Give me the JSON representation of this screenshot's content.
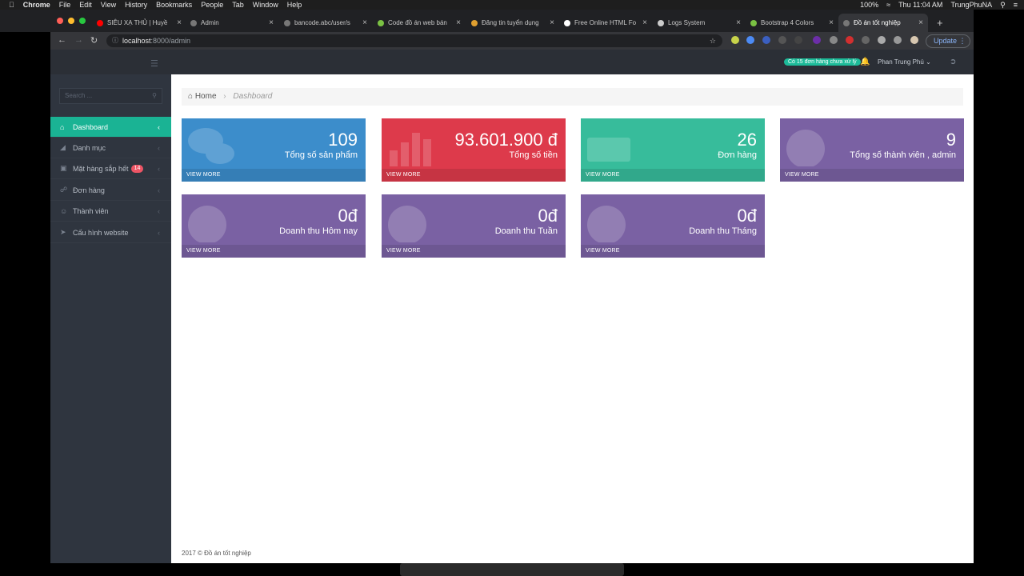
{
  "macmenu": {
    "apple": "",
    "app": "Chrome",
    "items": [
      "File",
      "Edit",
      "View",
      "History",
      "Bookmarks",
      "People",
      "Tab",
      "Window",
      "Help"
    ],
    "battery": "100%",
    "clock": "Thu 11:04 AM",
    "user": "TrungPhuNA"
  },
  "tabs": [
    {
      "label": "SIÊU XẠ THỦ | Huyề",
      "color": "#ff0000"
    },
    {
      "label": "Admin",
      "color": "#777777"
    },
    {
      "label": "bancode.abc/user/s",
      "color": "#777777"
    },
    {
      "label": "Code đồ án web bán",
      "color": "#7ac143"
    },
    {
      "label": "Đăng tin tuyển dụng",
      "color": "#e0a030"
    },
    {
      "label": "Free Online HTML Fo",
      "color": "#ffffff"
    },
    {
      "label": "Logs System",
      "color": "#cccccc"
    },
    {
      "label": "Bootstrap 4 Colors",
      "color": "#7ac143"
    },
    {
      "label": "Đồ án tốt nghiệp",
      "color": "#777777"
    }
  ],
  "address": {
    "host": "localhost",
    "path": ":8000/admin"
  },
  "browser": {
    "update_label": "Update"
  },
  "topbar": {
    "notification": "Có 15 đơn hàng chưa xử lý",
    "user_name": "Phan Trung Phú"
  },
  "sidebar": {
    "search_placeholder": "Search ...",
    "items": [
      {
        "label": "Dashboard"
      },
      {
        "label": "Danh mục"
      },
      {
        "label": "Mặt hàng sắp hết",
        "badge": "14"
      },
      {
        "label": "Đơn hàng"
      },
      {
        "label": "Thành viên"
      },
      {
        "label": "Cấu hình website"
      }
    ]
  },
  "breadcrumb": {
    "home": "Home",
    "current": "Dashboard"
  },
  "cards": [
    {
      "value": "109",
      "label": "Tổng số sản phẩm",
      "more": "VIEW MORE",
      "color": "#3c8dcb"
    },
    {
      "value": "93.601.900 đ",
      "label": "Tổng số tiền",
      "more": "VIEW MORE",
      "color": "#dd3a4b"
    },
    {
      "value": "26",
      "label": "Đơn hàng",
      "more": "VIEW MORE",
      "color": "#37bc9b"
    },
    {
      "value": "9",
      "label": "Tổng số thành viên , admin",
      "more": "VIEW MORE",
      "color": "#7a61a3"
    },
    {
      "value": "0đ",
      "label": "Doanh thu Hôm nay",
      "more": "VIEW MORE",
      "color": "#7a61a3"
    },
    {
      "value": "0đ",
      "label": "Doanh thu Tuần",
      "more": "VIEW MORE",
      "color": "#7a61a3"
    },
    {
      "value": "0đ",
      "label": "Doanh thu Tháng",
      "more": "VIEW MORE",
      "color": "#7a61a3"
    }
  ],
  "footer": "2017 © Đồ án tốt nghiệp"
}
